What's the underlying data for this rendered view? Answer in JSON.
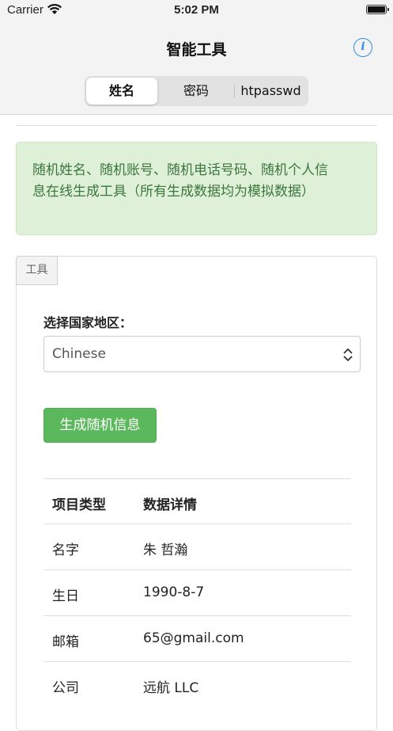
{
  "status_bar": {
    "carrier": "Carrier",
    "time": "5:02 PM"
  },
  "nav": {
    "title": "智能工具",
    "info_icon": "info-icon",
    "segments": [
      "姓名",
      "密码",
      "htpasswd"
    ],
    "active_segment": "姓名"
  },
  "alert": {
    "text": "随机姓名、随机账号、随机电话号码、随机个人信息在线生成工具（所有生成数据均为模拟数据）"
  },
  "panel": {
    "tab_label": "工具",
    "field_label": "选择国家地区：",
    "select_value": "Chinese",
    "button_label": "生成随机信息"
  },
  "table": {
    "headers": [
      "项目类型",
      "数据详情"
    ],
    "rows": [
      [
        "名字",
        "朱 哲瀚"
      ],
      [
        "生日",
        "1990-8-7"
      ],
      [
        "邮箱",
        "65@gmail.com"
      ],
      [
        "公司",
        "远航 LLC"
      ]
    ]
  },
  "colors": {
    "accent_blue": "#2f8ee6",
    "alert_bg": "#dff0d8",
    "alert_text": "#3c763d",
    "button_green": "#5cb85c"
  }
}
